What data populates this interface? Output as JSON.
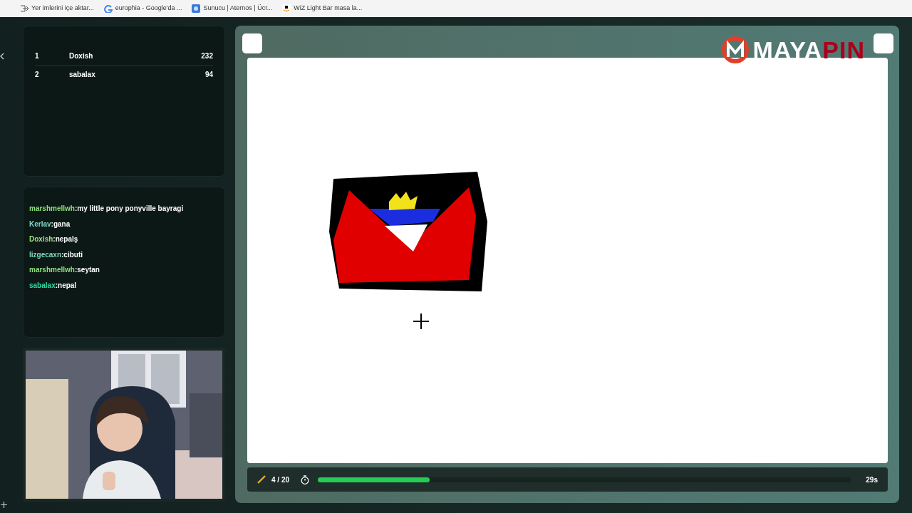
{
  "bookmarks": [
    {
      "label": "Yer imlerini içe aktar...",
      "kind": "import"
    },
    {
      "label": "europhia - Google'da ...",
      "kind": "google"
    },
    {
      "label": "Sunucu | Aternos | Ücr...",
      "kind": "server"
    },
    {
      "label": "WiZ Light Bar masa la...",
      "kind": "shop"
    }
  ],
  "leaderboard": [
    {
      "rank": "1",
      "name": "Doxish",
      "score": "232"
    },
    {
      "rank": "2",
      "name": "sabalax",
      "score": "94"
    }
  ],
  "chat": [
    {
      "user": "marshmellwh",
      "message": ":my little pony ponyville bayragi",
      "color": "#8ee07a"
    },
    {
      "user": "Kerlav",
      "message": ":gana",
      "color": "#7fd8c0"
    },
    {
      "user": "Doxish",
      "message": ":nepalş",
      "color": "#9fe07a"
    },
    {
      "user": "lizgecaxn",
      "message": ":cibuti",
      "color": "#7fd8c0"
    },
    {
      "user": "marshmellwh",
      "message": ":seytan",
      "color": "#8ee07a"
    },
    {
      "user": "sabalax",
      "message": ":nepal",
      "color": "#33d9a0"
    }
  ],
  "logo": {
    "first": "MAYA",
    "second": "PIN"
  },
  "status": {
    "round": "4 / 20",
    "timer": {
      "level": 0.21
    },
    "time_left": "29s"
  }
}
